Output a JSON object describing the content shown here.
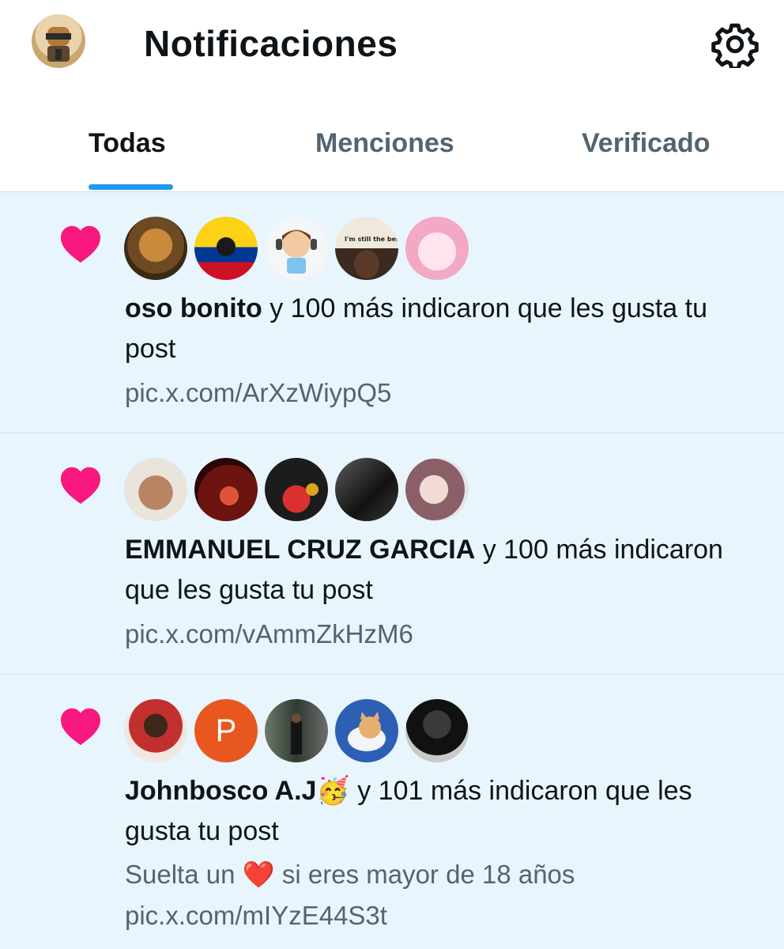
{
  "header": {
    "title": "Notificaciones",
    "profile_icon": "avatar-soldier",
    "settings_icon": "gear-icon"
  },
  "tabs": [
    {
      "label": "Todas",
      "active": true
    },
    {
      "label": "Menciones",
      "active": false
    },
    {
      "label": "Verificado",
      "active": false
    }
  ],
  "colors": {
    "accent": "#1d9bf0",
    "heart": "#f91880",
    "unread_bg": "#e8f5fd",
    "secondary_text": "#536471"
  },
  "notifications": [
    {
      "type": "like",
      "user": "oso bonito",
      "rest": " y 100 más indicaron que les gusta tu post",
      "link": "pic.x.com/ArXzWiypQ5",
      "avatars": [
        "lion",
        "colombia-flag",
        "cartoon-boy",
        "im-still-the-best",
        "pink-anime-girl"
      ]
    },
    {
      "type": "like",
      "user": "EMMANUEL CRUZ GARCIA",
      "rest": " y 100 más indicaron que les gusta tu post",
      "link": "pic.x.com/vAmmZkHzM6",
      "avatars": [
        "man-selfie",
        "red-figure",
        "footballer",
        "dark-room",
        "anime-guy"
      ]
    },
    {
      "type": "like",
      "user": "Johnbosco A.J🥳",
      "rest": " y 101 más indicaron que les gusta tu post",
      "extra_text": "Suelta un ❤️ si eres mayor de 18 años",
      "link": "pic.x.com/mIYzE44S3t",
      "avatars": [
        "man-red-shirt",
        "letter-p",
        "man-in-suit",
        "cartoon-cat",
        "man-dark-hoodie"
      ],
      "letter_avatar": "P"
    }
  ]
}
